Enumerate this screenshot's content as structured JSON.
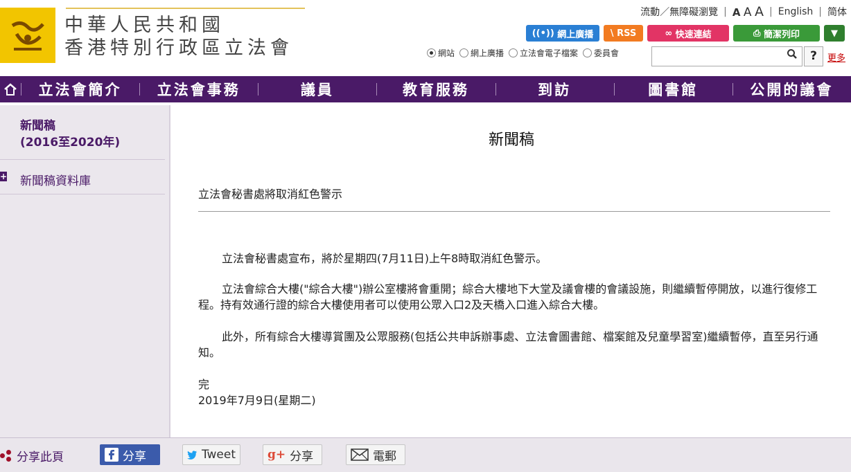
{
  "header": {
    "title_line1": "中華人民共和國",
    "title_line2": "香港特別行政區立法會",
    "top_links": {
      "accessibility": "流動／無障礙瀏覽",
      "font_a1": "A",
      "font_a2": "A",
      "font_a3": "A",
      "english": "English",
      "simplified": "简体",
      "separator": "|"
    },
    "buttons": {
      "webcast": "網上廣播",
      "rss": "RSS",
      "quick_links": "快速連結",
      "print": "簡潔列印"
    },
    "search": {
      "scopes": [
        "網站",
        "網上廣播",
        "立法會電子檔案",
        "委員會"
      ],
      "selected_scope": "網站",
      "query": "",
      "help": "?",
      "more": "更多"
    }
  },
  "nav": {
    "items": [
      "立法會簡介",
      "立法會事務",
      "議員",
      "教育服務",
      "到訪",
      "圖書館",
      "公開的議會"
    ]
  },
  "sidebar": {
    "title_line1": "新聞稿",
    "title_line2_open": "(2016",
    "title_line2_mid": "至",
    "title_line2_close": "2020年)",
    "item": "新聞稿資料庫",
    "plus": "+"
  },
  "main": {
    "page_title": "新聞稿",
    "headline": "立法會秘書處將取消紅色警示",
    "paragraphs": [
      "立法會秘書處宣布，將於星期四(7月11日)上午8時取消紅色警示。",
      "立法會綜合大樓(\"綜合大樓\")辦公室樓將會重開；綜合大樓地下大堂及議會樓的會議設施，則繼續暫停開放，以進行復修工程。持有效通行證的綜合大樓使用者可以使用公眾入口2及天橋入口進入綜合大樓。",
      "此外，所有綜合大樓導賞團及公眾服務(包括公共申訴辦事處、立法會圖書館、檔案館及兒童學習室)繼續暫停，直至另行通知。"
    ],
    "end_mark": "完",
    "date": "2019年7月9日(星期二)"
  },
  "footer": {
    "share_label": "分享此頁",
    "facebook": "分享",
    "twitter": "Tweet",
    "googleplus": "分享",
    "email": "電郵"
  },
  "colors": {
    "brand_purple": "#4a1a67",
    "logo_yellow": "#f2c500",
    "facebook_blue": "#3b5bab"
  },
  "icons": [
    "legco-logo-icon",
    "home-icon",
    "search-icon",
    "webcast-icon",
    "rss-icon",
    "link-icon",
    "printer-icon",
    "chevron-down-icon",
    "share-icon",
    "facebook-icon",
    "twitter-icon",
    "googleplus-icon",
    "email-icon"
  ]
}
